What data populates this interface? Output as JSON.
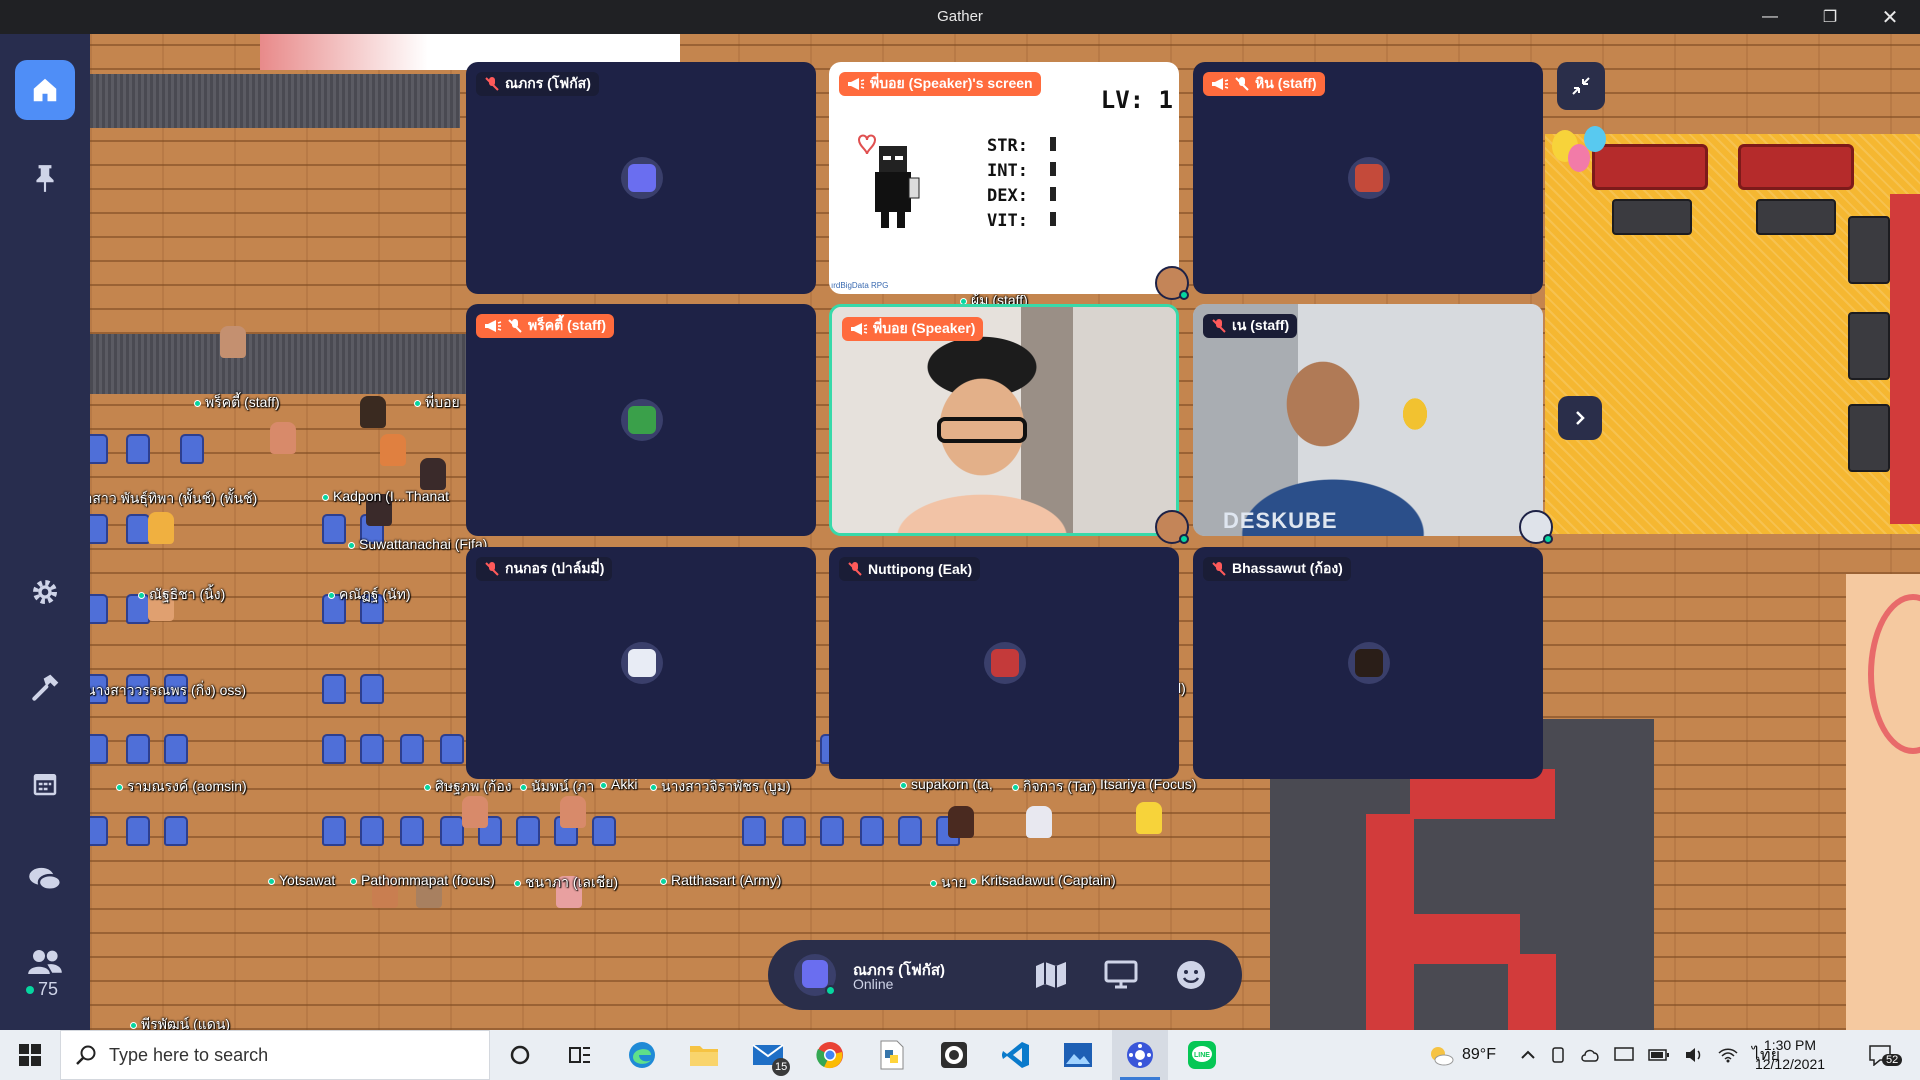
{
  "window": {
    "title": "Gather"
  },
  "sidebar": {
    "online_count": "75"
  },
  "map_labels": [
    {
      "text": "พร็คตี้ (staff)"
    },
    {
      "text": "พี่บอย"
    },
    {
      "text": "อสาว พันธุ์ทิพา (พั้นช์) (พั้นช์)"
    },
    {
      "text": "Kadpon (I...Thanat"
    },
    {
      "text": "Suwattanachai (Fifa)"
    },
    {
      "text": "ณัฐธิชา (นิ้ง)"
    },
    {
      "text": "คณัฏฐ์ (นัท)"
    },
    {
      "text": "นางสาววรรณพร (กิ่ง) oss)"
    },
    {
      "text": "รามณรงค์ (aomsin)"
    },
    {
      "text": "ศิษฐภพ (ก้อง"
    },
    {
      "text": "นัมพน์ (ภา"
    },
    {
      "text": "Akki"
    },
    {
      "text": "นางสาวจิราพัชร (บูม)"
    },
    {
      "text": "supakorn (ta,"
    },
    {
      "text": "กิจการ (Tar)"
    },
    {
      "text": "Itsariya (Focus)"
    },
    {
      "text": "Yotsawat"
    },
    {
      "text": "Pathommapat (focus)"
    },
    {
      "text": "ชนาภา (เลเชีย)"
    },
    {
      "text": "Ratthasart (Army)"
    },
    {
      "text": "นาย"
    },
    {
      "text": "Kritsadawut (Captain)"
    },
    {
      "text": "พีรพัฒน์ (แดน)"
    },
    {
      "text": "ผ้ม (staff)"
    },
    {
      "text": "l)"
    }
  ],
  "tiles": [
    {
      "label": "ณภกร (โฟกัส)",
      "megaphone": false,
      "muted": true
    },
    {
      "label": "พี่บอย (Speaker)'s screen",
      "megaphone": true,
      "muted": false
    },
    {
      "label": "หิน (staff)",
      "megaphone": true,
      "muted": true
    },
    {
      "label": "พร็คตี้ (staff)",
      "megaphone": true,
      "muted": true
    },
    {
      "label": "พี่บอย (Speaker)",
      "megaphone": true,
      "muted": false
    },
    {
      "label": "เน (staff)",
      "megaphone": false,
      "muted": true
    },
    {
      "label": "กนกอร (ปาล์มมี่)",
      "megaphone": false,
      "muted": true
    },
    {
      "label": "Nuttipong (Eak)",
      "megaphone": false,
      "muted": true
    },
    {
      "label": "Bhassawut (ก้อง)",
      "megaphone": false,
      "muted": true
    }
  ],
  "shared_screen": {
    "level": "LV: 1",
    "stats": [
      "STR:",
      "INT:",
      "DEX:",
      "VIT:"
    ],
    "credit": "ırdBigData RPG"
  },
  "webcam_shirt_text": "DESKUBE",
  "user_bar": {
    "name": "ณภกร (โฟกัส)",
    "status": "Online"
  },
  "taskbar": {
    "search_placeholder": "Type here to search",
    "mail_badge": "15",
    "weather": "89°F",
    "language": "ไทย",
    "time": "1:30 PM",
    "date": "12/12/2021",
    "notifications": "52"
  },
  "colors": {
    "speaker_label": "#ff6b3d",
    "tile_bg": "#1e2246",
    "sidebar_bg": "#282d4e",
    "active_accent": "#4f8ef7",
    "online": "#06d6a0"
  }
}
